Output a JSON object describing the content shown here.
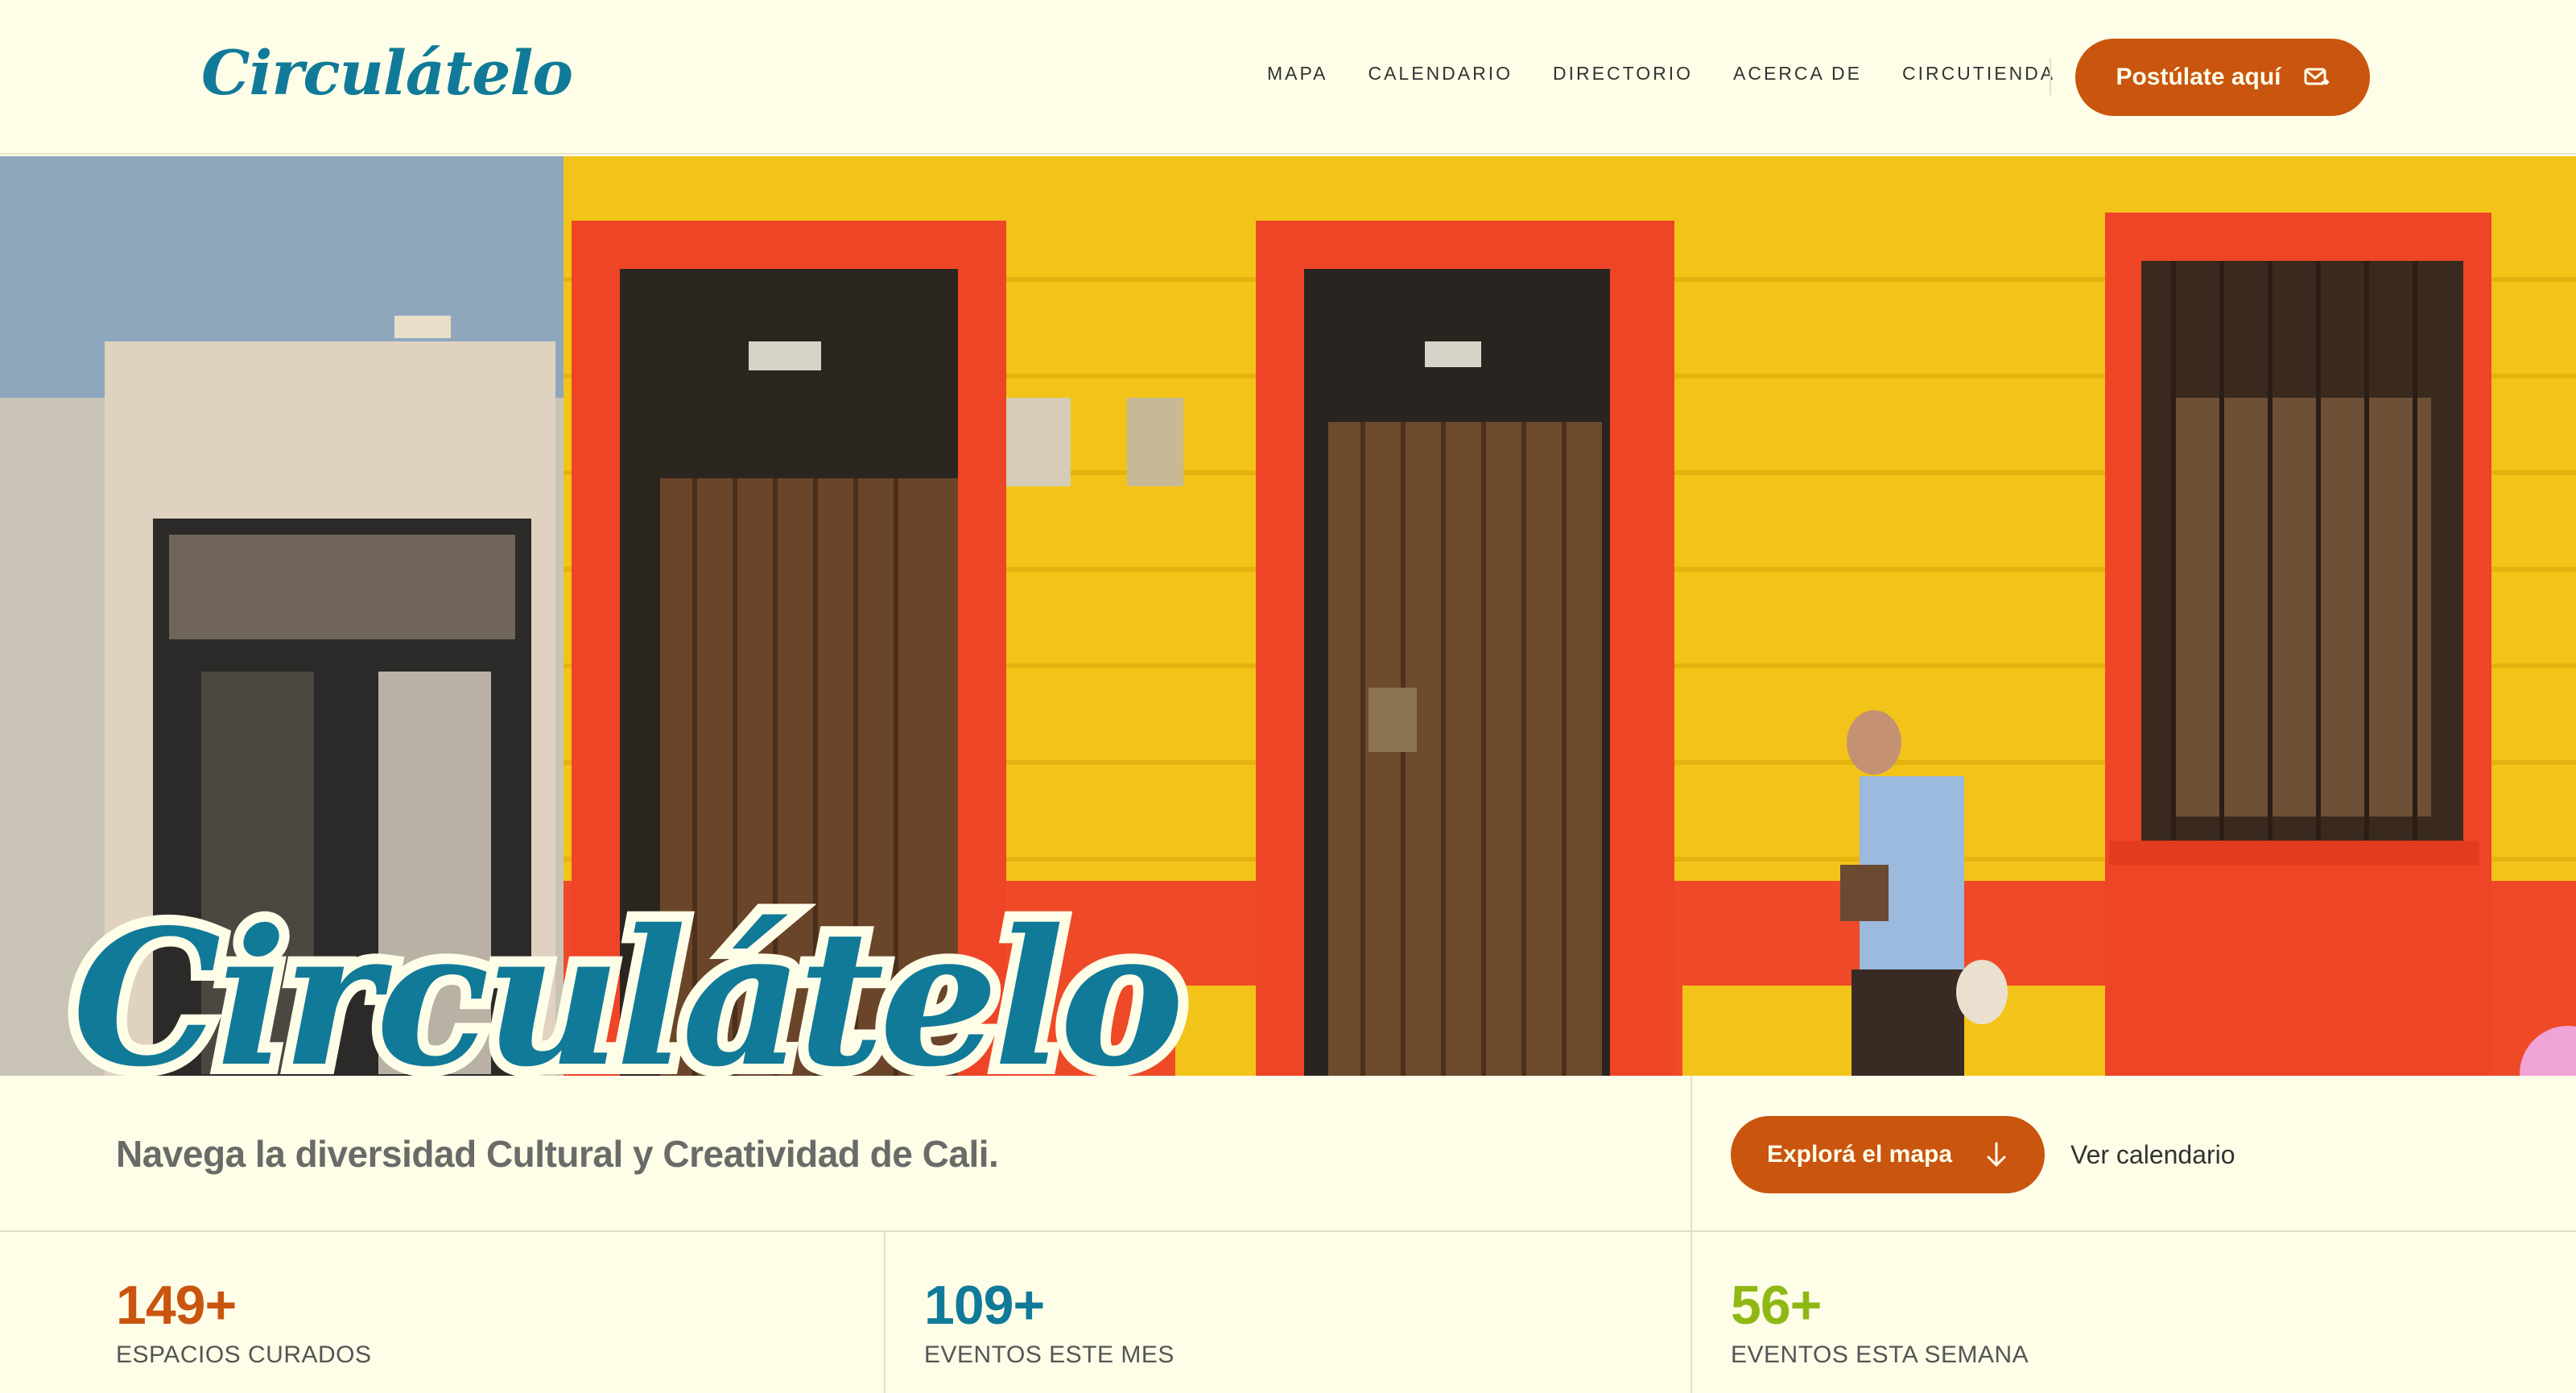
{
  "header": {
    "logo": "Circulátelo",
    "nav": [
      "MAPA",
      "CALENDARIO",
      "DIRECTORIO",
      "ACERCA DE",
      "CIRCUTIENDA"
    ],
    "apply_label": "Postúlate aquí"
  },
  "hero": {
    "big_title": "Circulátelo"
  },
  "tagline": {
    "text": "Navega la diversidad Cultural y Creatividad de Cali.",
    "map_button": "Explorá el mapa",
    "calendar_link": "Ver calendario"
  },
  "stats": [
    {
      "value": "149+",
      "label": "ESPACIOS CURADOS",
      "color": "#c9550f"
    },
    {
      "value": "109+",
      "label": "EVENTOS ESTE MES",
      "color": "#117a98"
    },
    {
      "value": "56+",
      "label": "EVENTOS ESTA SEMANA",
      "color": "#8fb814"
    }
  ],
  "colors": {
    "accent": "#c9550f",
    "brand": "#117a98",
    "background": "#fdfde8"
  }
}
